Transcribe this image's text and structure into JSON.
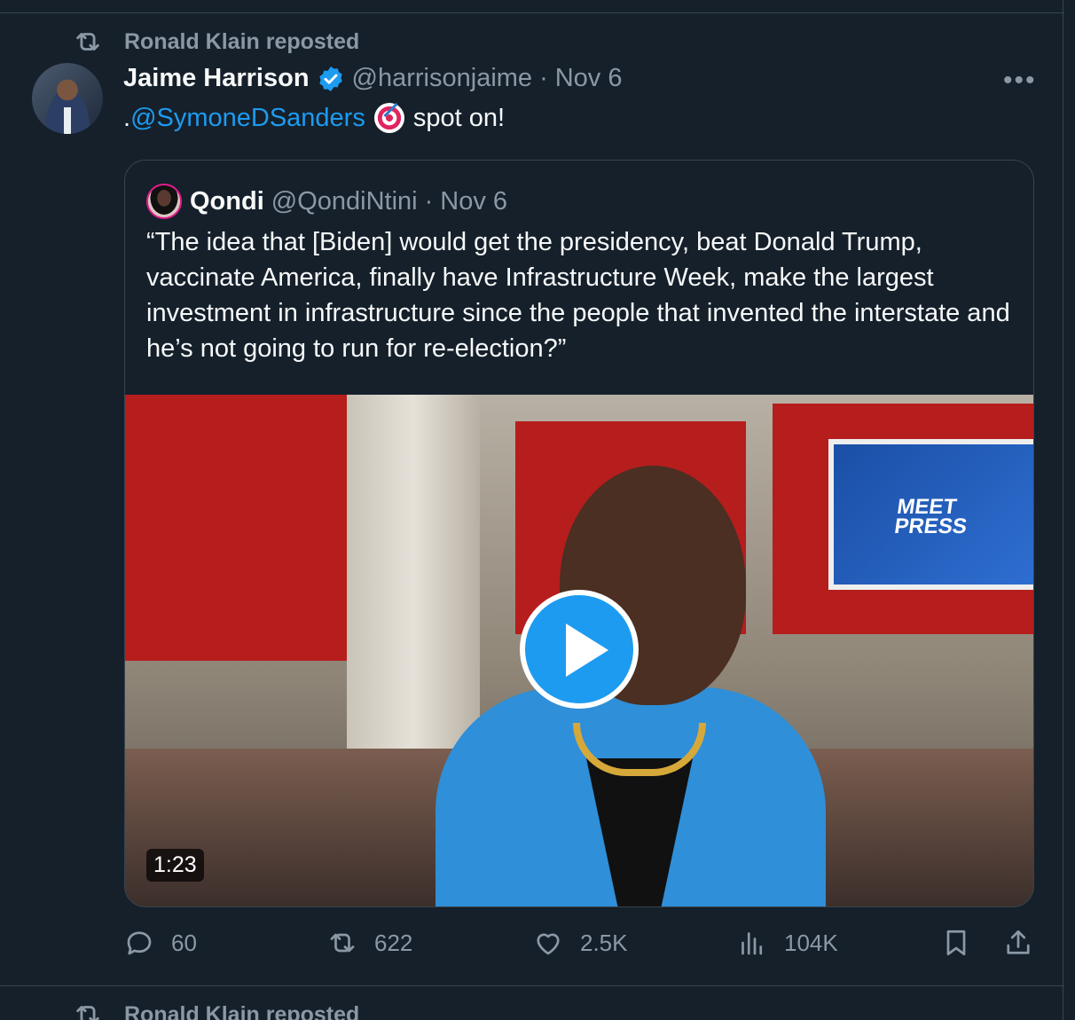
{
  "repost_banner": {
    "text": "Ronald Klain reposted"
  },
  "tweet": {
    "author_name": "Jaime Harrison",
    "handle": "@harrisonjaime",
    "separator": "·",
    "date": "Nov 6",
    "more_label": "•••",
    "text_prefix": ".",
    "mention": "@SymoneDSanders",
    "text_suffix": "spot on!"
  },
  "quote": {
    "author_name": "Qondi",
    "handle": "@QondiNtini",
    "separator": "·",
    "date": "Nov 6",
    "text": "“The idea that [Biden] would get the presidency, beat Donald Trump, vaccinate America, finally have Infrastructure Week, make the largest investment in infrastructure since the people that invented the interstate and he’s not going to run for re-election?”",
    "video": {
      "duration": "1:23",
      "screen_text_line1": "MEET",
      "screen_text_line2": "PRESS"
    }
  },
  "actions": {
    "replies": "60",
    "reposts": "622",
    "likes": "2.5K",
    "views": "104K"
  },
  "next_repost_banner": {
    "text": "Ronald Klain reposted"
  },
  "colors": {
    "background": "#15202b",
    "accent": "#1d9bf0",
    "secondary_text": "#8b98a5",
    "border": "#38444d"
  }
}
